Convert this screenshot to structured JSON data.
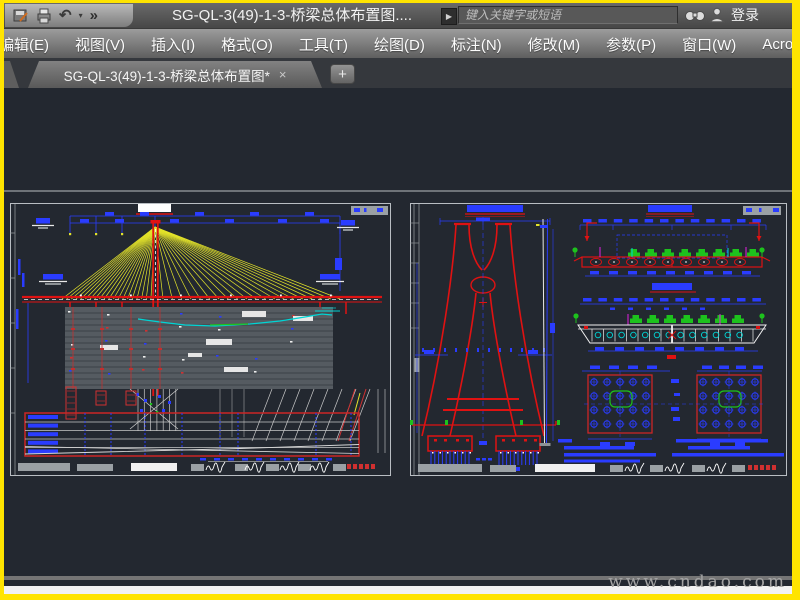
{
  "titlebar": {
    "title": "SG-QL-3(49)-1-3-桥梁总体布置图....",
    "search_placeholder": "键入关键字或短语",
    "login_label": "登录",
    "glyphs": {
      "play": "▶",
      "caret": "▾",
      "more": "»",
      "undo": "↶"
    },
    "icon_names": [
      "save-icon",
      "print-icon",
      "undo-icon",
      "undo-dropdown-icon",
      "more-tools-icon",
      "binoculars-icon",
      "user-icon"
    ]
  },
  "menubar": {
    "items": [
      "编辑(E)",
      "视图(V)",
      "插入(I)",
      "格式(O)",
      "工具(T)",
      "绘图(D)",
      "标注(N)",
      "修改(M)",
      "参数(P)",
      "窗口(W)",
      "Acrobat"
    ]
  },
  "tabbar": {
    "active_tab": "SG-QL-3(49)-1-3-桥梁总体布置图*",
    "close_glyph": "×",
    "new_tab_glyph": "+"
  },
  "canvas": {
    "watermark": "www.cndao.com",
    "left_sheet": "bridge-general-elevation",
    "right_sheet": "pylon-elevation-and-deck-sections"
  },
  "colors": {
    "window_frame": "#ffe400",
    "canvas_bg": "#232830",
    "cad_red": "#e01212",
    "cad_blue": "#2a3cff",
    "cad_yellow": "#e3e32a",
    "cad_cyan": "#00d5d5",
    "cad_green": "#1dc21d",
    "cad_magenta": "#e020e0",
    "sheet_gray": "#9aa0a4"
  }
}
